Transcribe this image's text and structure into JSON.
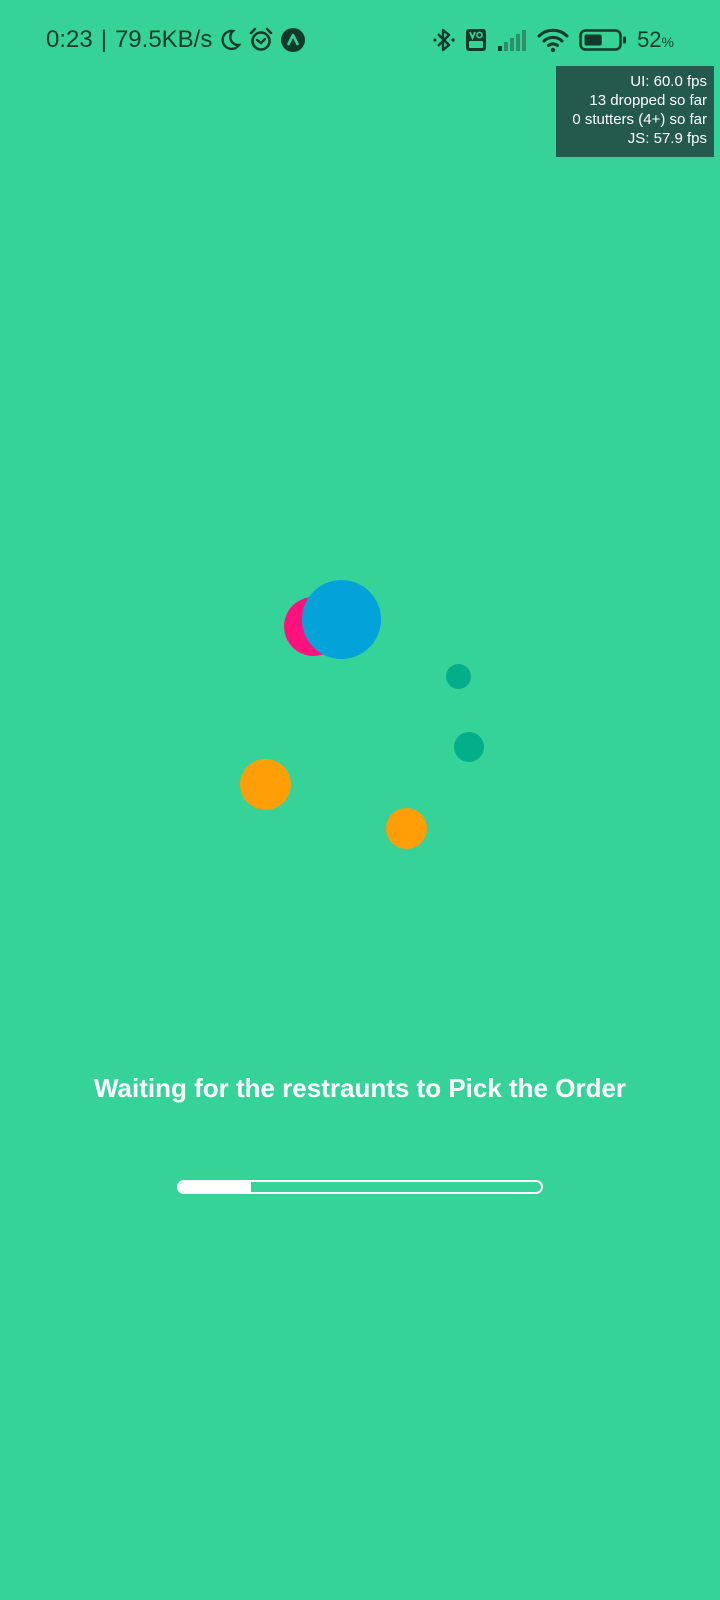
{
  "colors": {
    "background": "#36d399",
    "status_text": "#103b2b",
    "perf_overlay_bg": "#235a4c",
    "dot_pink": "#ff127c",
    "dot_blue": "#03a3da",
    "dot_teal": "#03af8a",
    "dot_orange": "#ff9e06",
    "message_text": "#ffffff",
    "progress": "#ffffff"
  },
  "status_bar": {
    "time": "0:23",
    "separator": "|",
    "network_speed": "79.5KB/s",
    "left_icons": [
      "moon-icon",
      "alarm-icon",
      "app-notification-icon"
    ],
    "right_icons": [
      "bluetooth-icon",
      "volte-icon",
      "signal-icon",
      "wifi-icon",
      "battery-icon"
    ],
    "battery_percent": "52",
    "battery_unit": "%",
    "battery_level": 0.52
  },
  "perf_monitor": {
    "ui_fps": "UI: 60.0 fps",
    "dropped": "13 dropped so far",
    "stutters": "0 stutters (4+) so far",
    "js_fps": "JS: 57.9 fps"
  },
  "message": "Waiting for the restraunts to Pick the Order",
  "progress": {
    "fraction": 0.2
  }
}
